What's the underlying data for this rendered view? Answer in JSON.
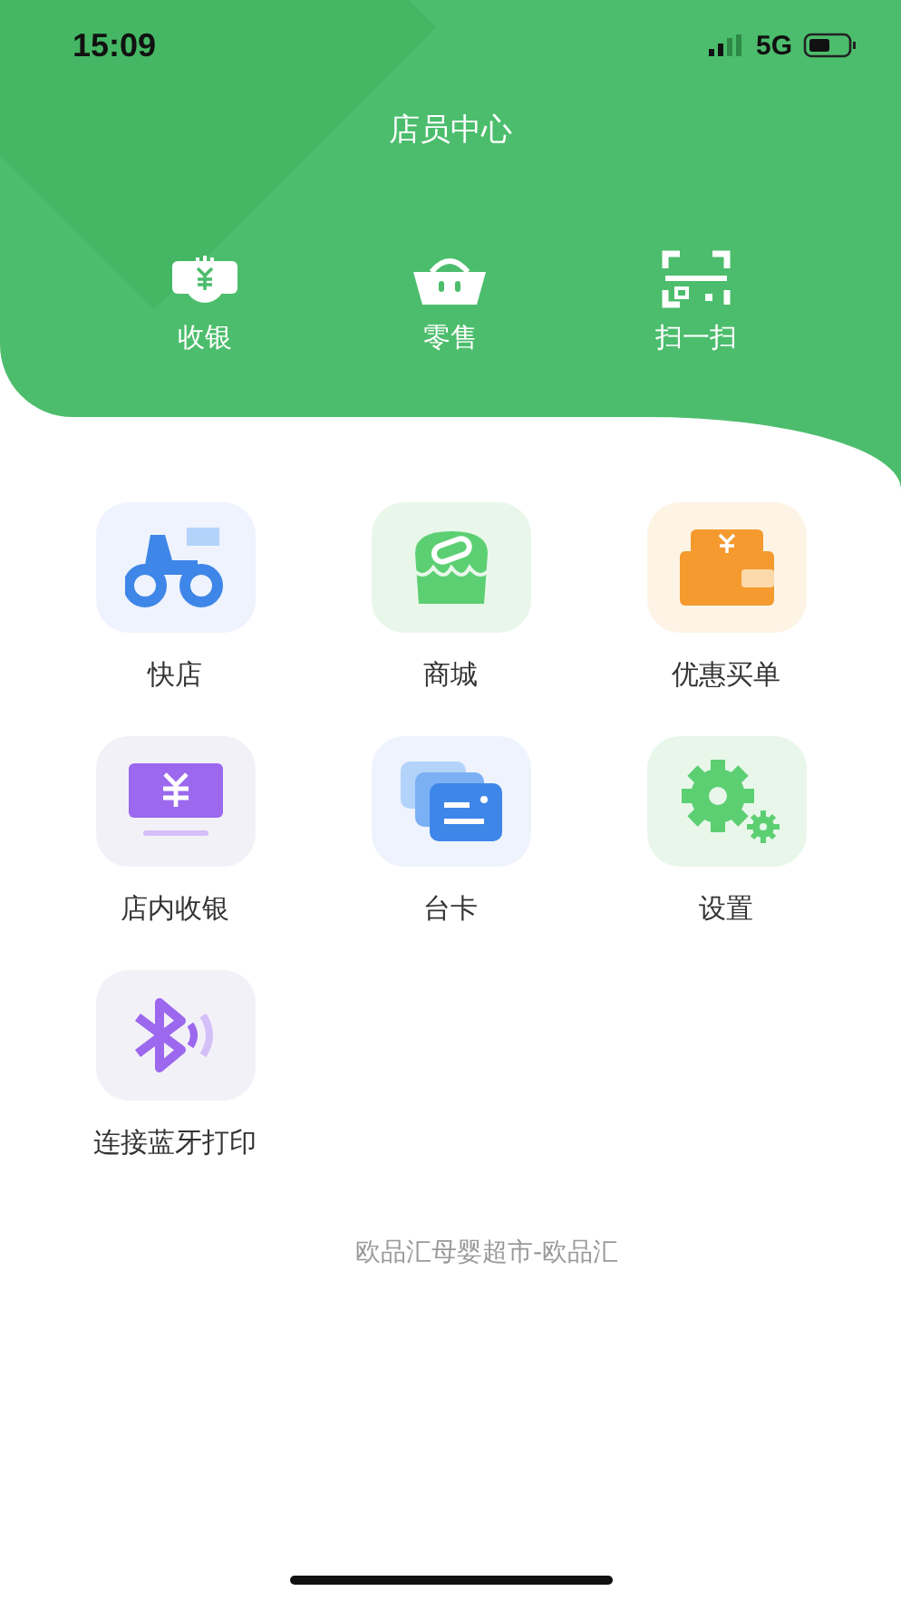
{
  "status_bar": {
    "time": "15:09",
    "network": "5G"
  },
  "header": {
    "title": "店员中心"
  },
  "quick_actions": [
    {
      "label": "收银"
    },
    {
      "label": "零售"
    },
    {
      "label": "扫一扫"
    }
  ],
  "menu": [
    {
      "label": "快店"
    },
    {
      "label": "商城"
    },
    {
      "label": "优惠买单"
    },
    {
      "label": "店内收银"
    },
    {
      "label": "台卡"
    },
    {
      "label": "设置"
    },
    {
      "label": "连接蓝牙打印"
    }
  ],
  "footer": "欧品汇母婴超市-欧品汇"
}
